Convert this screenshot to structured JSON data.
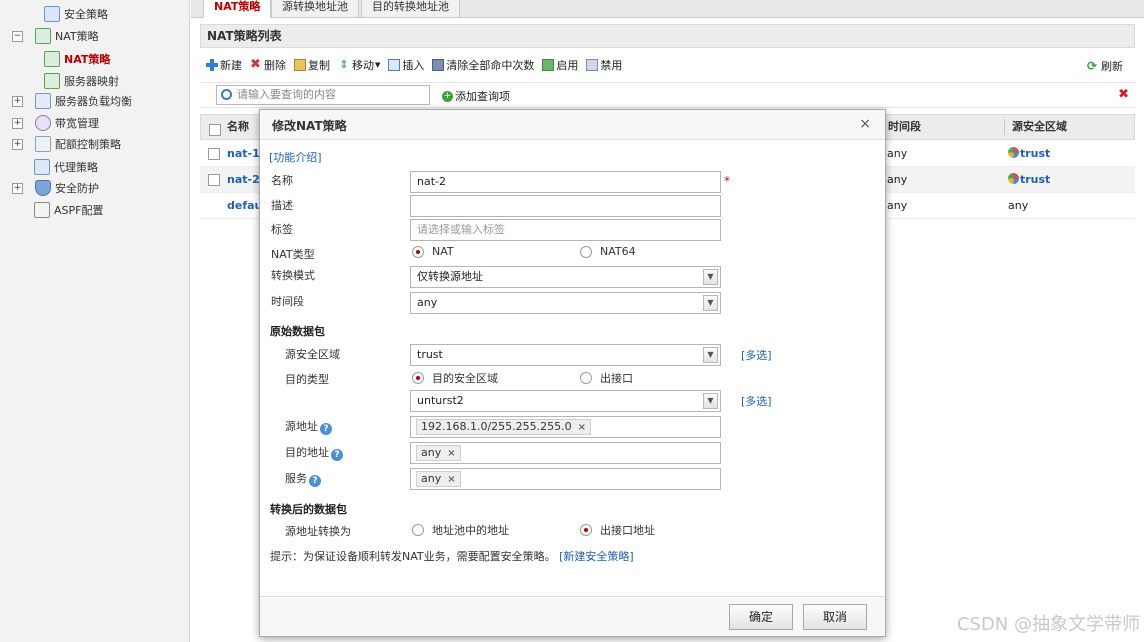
{
  "sidebar": {
    "items": [
      {
        "label": "安全策略",
        "icon": "security-policy-icon"
      },
      {
        "label": "NAT策略",
        "icon": "nat-policy-icon",
        "expander": "−"
      },
      {
        "label": "NAT策略",
        "icon": "nat-policy-icon"
      },
      {
        "label": "服务器映射",
        "icon": "server-mapping-icon"
      },
      {
        "label": "服务器负载均衡",
        "icon": "load-balance-icon",
        "expander": "+"
      },
      {
        "label": "带宽管理",
        "icon": "bandwidth-icon",
        "expander": "+"
      },
      {
        "label": "配额控制策略",
        "icon": "quota-icon",
        "expander": "+"
      },
      {
        "label": "代理策略",
        "icon": "proxy-icon"
      },
      {
        "label": "安全防护",
        "icon": "shield-icon",
        "expander": "+"
      },
      {
        "label": "ASPF配置",
        "icon": "aspf-icon"
      }
    ]
  },
  "tabs": [
    "NAT策略",
    "源转换地址池",
    "目的转换地址池"
  ],
  "panel_title": "NAT策略列表",
  "toolbar": {
    "new": "新建",
    "delete": "删除",
    "copy": "复制",
    "move": "移动",
    "insert": "插入",
    "clear_hits": "清除全部命中次数",
    "enable": "启用",
    "disable": "禁用",
    "refresh": "刷新"
  },
  "search": {
    "placeholder": "请输入要查询的内容",
    "add_query": "添加查询项"
  },
  "table": {
    "headers": {
      "name": "名称",
      "time_range": "时间段",
      "src_zone": "源安全区域"
    },
    "rows": [
      {
        "name": "nat-1",
        "time": "any",
        "zone": "trust"
      },
      {
        "name": "nat-2",
        "time": "any",
        "zone": "trust"
      },
      {
        "name": "defaul",
        "time": "any",
        "zone": "any"
      }
    ]
  },
  "dialog": {
    "title": "修改NAT策略",
    "close": "×",
    "intro_link": "[功能介绍]",
    "labels": {
      "name": "名称",
      "desc": "描述",
      "tag": "标签",
      "nat_type": "NAT类型",
      "mode": "转换模式",
      "time": "时间段",
      "orig_section": "原始数据包",
      "src_zone": "源安全区域",
      "dst_type": "目的类型",
      "src_addr": "源地址",
      "dst_addr": "目的地址",
      "service": "服务",
      "trans_section": "转换后的数据包",
      "src_trans": "源地址转换为"
    },
    "values": {
      "name": "nat-2",
      "desc": "",
      "tag_placeholder": "请选择或输入标签",
      "nat_type_opt1": "NAT",
      "nat_type_opt2": "NAT64",
      "mode": "仅转换源地址",
      "time": "any",
      "src_zone": "trust",
      "dst_type_opt1": "目的安全区域",
      "dst_type_opt2": "出接口",
      "dst_zone": "unturst2",
      "src_addr": "192.168.1.0/255.255.255.0",
      "dst_addr": "any",
      "service": "any",
      "src_trans_opt1": "地址池中的地址",
      "src_trans_opt2": "出接口地址"
    },
    "multi_select": "[多选]",
    "required_mark": "*",
    "help_glyph": "?",
    "tag_remove": "×",
    "hint": "提示：为保证设备顺利转发NAT业务，需要配置安全策略。",
    "hint_link": "[新建安全策略]",
    "ok": "确定",
    "cancel": "取消"
  },
  "watermark": "CSDN @抽象文学带师",
  "colors": {
    "accent_red": "#c00000",
    "link_blue": "#1f5fb8"
  }
}
